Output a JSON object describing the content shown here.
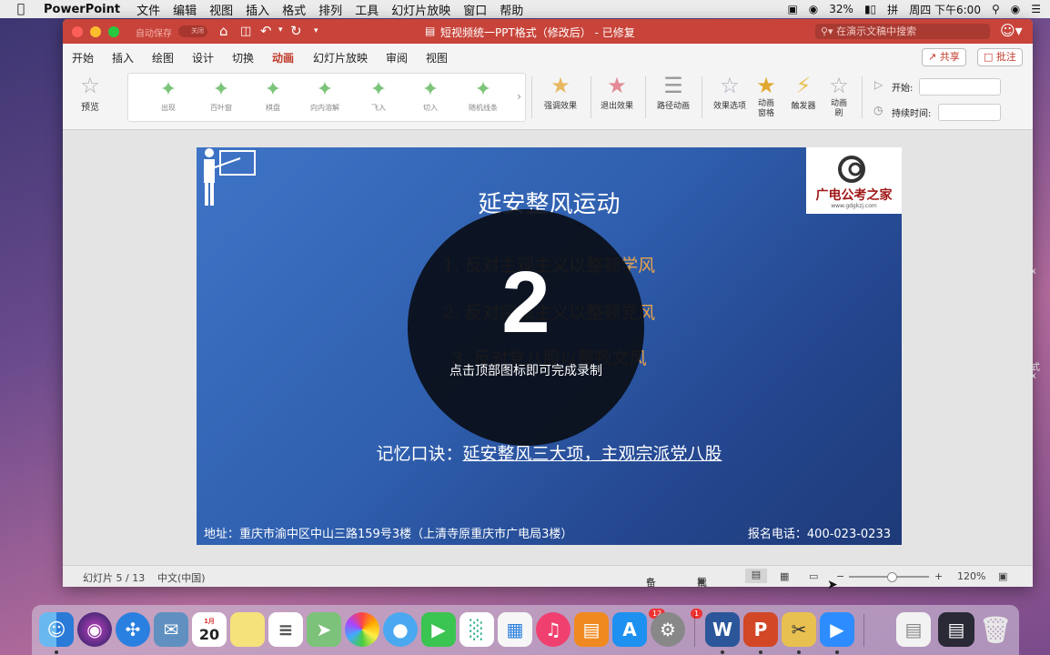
{
  "menubar": {
    "app": "PowerPoint",
    "items": [
      "文件",
      "编辑",
      "视图",
      "插入",
      "格式",
      "排列",
      "工具",
      "幻灯片放映",
      "窗口",
      "帮助"
    ],
    "battery": "32%",
    "clock": "周四 下午6:00"
  },
  "titlebar": {
    "autosave": "自动保存",
    "autosave_state": "关闭",
    "title": "短视频统一PPT格式（修改后） - 已修复",
    "search_placeholder": "在演示文稿中搜索"
  },
  "tabs": [
    "开始",
    "插入",
    "绘图",
    "设计",
    "切换",
    "动画",
    "幻灯片放映",
    "审阅",
    "视图"
  ],
  "active_tab": "动画",
  "share_label": "共享",
  "comment_label": "批注",
  "ribbon": {
    "preview": "预览",
    "effects": [
      "出现",
      "百叶窗",
      "棋盘",
      "向内溶解",
      "飞入",
      "切入",
      "随机线条"
    ],
    "emphasis": "强调效果",
    "exit": "退出效果",
    "path": "路径动画",
    "effect_options": "效果选项",
    "anim_pane": "动画窗格",
    "trigger": "触发器",
    "anim_painter": "动画刷",
    "start_label": "开始:",
    "duration_label": "持续时间:"
  },
  "slide": {
    "title": "延安整风运动",
    "points": [
      "1. 反对主观主义以整顿学风",
      "2. 反对宗派主义以整顿党风",
      "3. 反对党八股以整顿文风"
    ],
    "mnemonic_prefix": "记忆口诀：",
    "mnemonic_text": "延安整风三大项，主观宗派党八股",
    "address": "地址：重庆市渝中区中山三路159号3楼（上清寺原重庆市广电局3楼）",
    "phone": "报名电话：400-023-0233",
    "logo_text": "广电公考之家",
    "logo_url": "www.gdgkzj.com"
  },
  "overlay": {
    "countdown": "2",
    "hint": "点击顶部图标即可完成录制"
  },
  "status": {
    "slide_info": "幻灯片 5 / 13",
    "language": "中文(中国)",
    "notes": "备注",
    "comments": "批注",
    "zoom": "120%"
  },
  "dock": {
    "calendar_month": "1月",
    "calendar_day": "20",
    "appstore_badge": "12",
    "prefs_badge": "1"
  }
}
